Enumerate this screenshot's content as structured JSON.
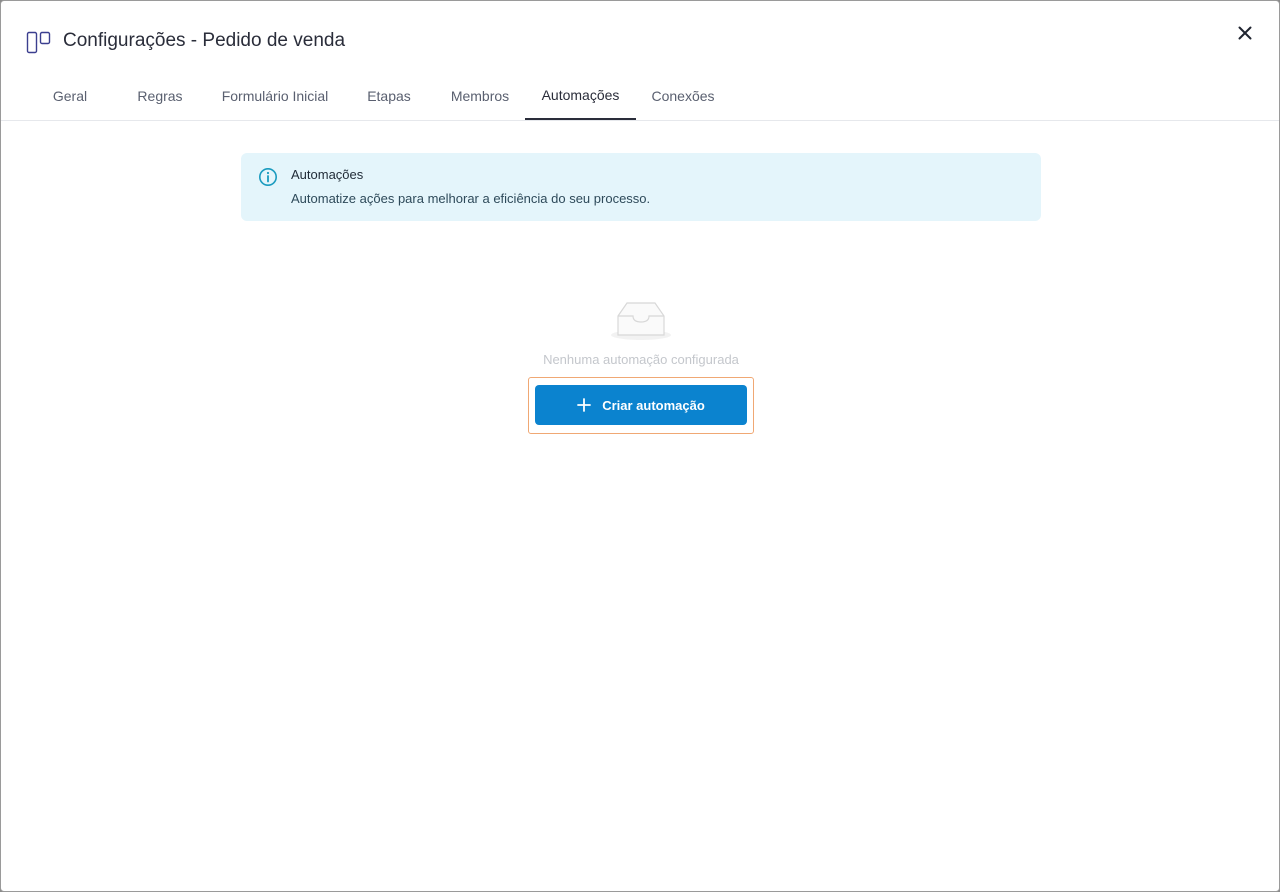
{
  "header": {
    "title": "Configurações - Pedido de venda",
    "icon": "board-columns-icon"
  },
  "close": {
    "icon": "close-icon"
  },
  "tabs": [
    {
      "label": "Geral",
      "active": false
    },
    {
      "label": "Regras",
      "active": false
    },
    {
      "label": "Formulário Inicial",
      "active": false
    },
    {
      "label": "Etapas",
      "active": false
    },
    {
      "label": "Membros",
      "active": false
    },
    {
      "label": "Automações",
      "active": true
    },
    {
      "label": "Conexões",
      "active": false
    }
  ],
  "info": {
    "icon": "info-icon",
    "title": "Automações",
    "text": "Automatize ações para melhorar a eficiência do seu processo."
  },
  "empty_state": {
    "icon": "empty-inbox-icon",
    "text": "Nenhuma automação configurada"
  },
  "create_button": {
    "label": "Criar automação",
    "icon": "plus-icon"
  },
  "colors": {
    "accent": "#0b83cf",
    "info_bg": "#e4f5fb",
    "info_icon": "#1a9bbf",
    "focus_ring": "#f0a874",
    "active_tab": "#2a2d3a"
  }
}
